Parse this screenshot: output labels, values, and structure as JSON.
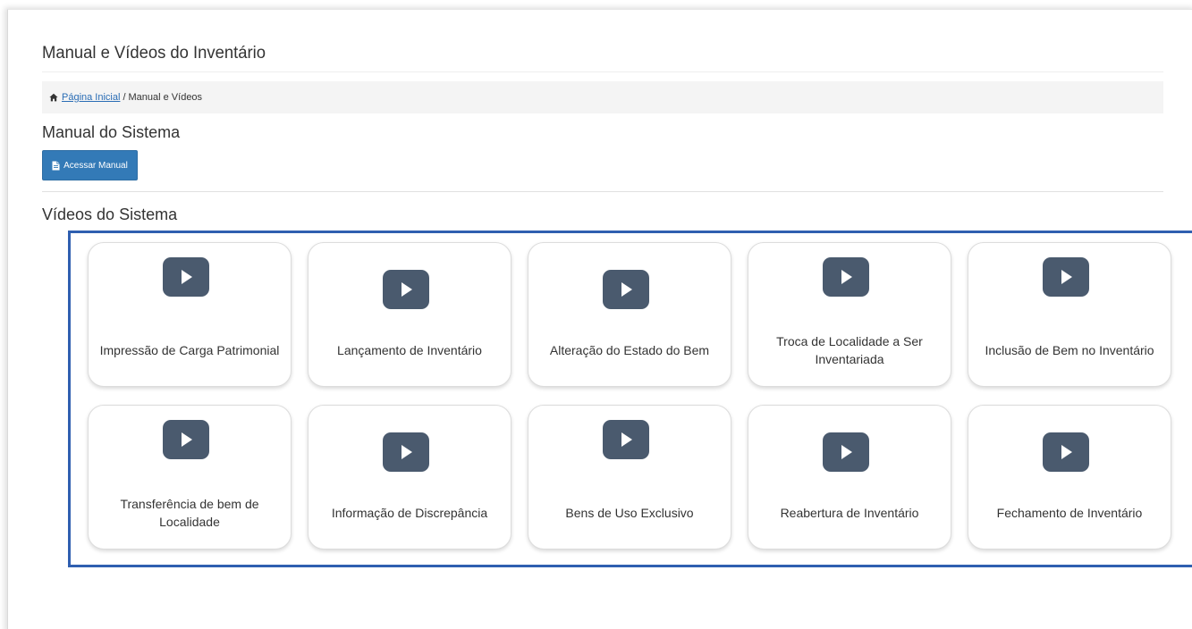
{
  "page": {
    "title": "Manual e Vídeos do Inventário"
  },
  "breadcrumb": {
    "home_label": "Página Inicial",
    "separator": "/",
    "current": "Manual e Vídeos"
  },
  "manual_section": {
    "title": "Manual do Sistema",
    "button_label": "Acessar Manual"
  },
  "videos_section": {
    "title": "Vídeos do Sistema",
    "videos": [
      {
        "label": "Impressão de Carga Patrimonial",
        "icon": "play-icon"
      },
      {
        "label": "Lançamento de Inventário",
        "icon": "play-icon"
      },
      {
        "label": "Alteração do Estado do Bem",
        "icon": "play-icon"
      },
      {
        "label": "Troca de Localidade a Ser Inventariada",
        "icon": "play-icon"
      },
      {
        "label": "Inclusão de Bem no Inventário",
        "icon": "play-icon"
      },
      {
        "label": "Transferência de bem de Localidade",
        "icon": "play-icon"
      },
      {
        "label": "Informação de Discrepância",
        "icon": "play-icon"
      },
      {
        "label": "Bens de Uso Exclusivo",
        "icon": "play-icon"
      },
      {
        "label": "Reabertura de Inventário",
        "icon": "play-icon"
      },
      {
        "label": "Fechamento de Inventário",
        "icon": "play-icon"
      }
    ]
  },
  "colors": {
    "primary_button": "#337ab7",
    "link": "#2a6db5",
    "video_box_border": "#2f5fb0",
    "play_icon": "#4a5a6e"
  }
}
